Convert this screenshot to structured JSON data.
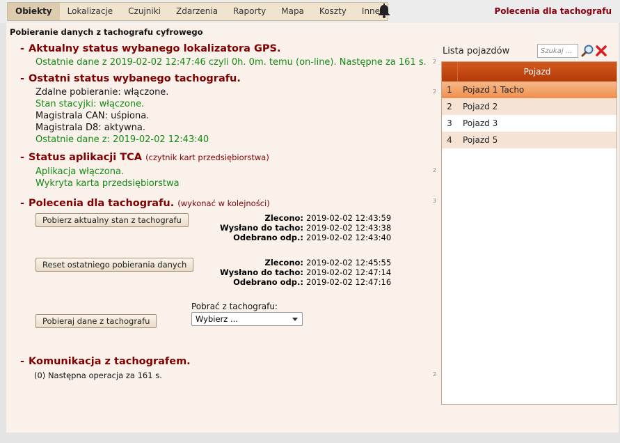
{
  "menu": [
    "Obiekty",
    "Lokalizacje",
    "Czujniki",
    "Zdarzenia",
    "Raporty",
    "Mapa",
    "Koszty",
    "Inne"
  ],
  "page_heading": "Polecenia dla tachografu",
  "subtitle": "Pobieranie danych z tachografu cyfrowego",
  "gps": {
    "title": "Aktualny status wybanego lokalizatora GPS.",
    "line": "Ostatnie dane z 2019-02-02 12:47:46 czyli 0h. 0m. temu (on-line). Następne za 161 s."
  },
  "tacho": {
    "title": "Ostatni status wybanego tachografu.",
    "lines": [
      "Zdalne pobieranie: włączone.",
      "Stan stacyjki: włączone.",
      "Magistrala CAN: uśpiona.",
      "Magistrala D8: aktywna.",
      "Ostatnie dane z: 2019-02-02 12:43:40"
    ]
  },
  "tca": {
    "title": "Status aplikacji TCA",
    "note": "(czytnik kart przedsiębiorstwa)",
    "lines": [
      "Aplikacja włączona.",
      "Wykryta karta przedsiębiorstwa"
    ]
  },
  "commands": {
    "title": "Polecenia dla tachografu.",
    "note": "(wykonać w kolejności)",
    "labels": {
      "ordered": "Zlecono:",
      "sent": "Wysłano do tacho:",
      "received": "Odebrano odp.:"
    },
    "items": [
      {
        "button": "Pobierz aktualny stan z tachografu",
        "ordered": "2019-02-02 12:43:59",
        "sent": "2019-02-02 12:43:38",
        "received": "2019-02-02 12:43:40"
      },
      {
        "button": "Reset ostatniego pobierania danych",
        "ordered": "2019-02-02 12:45:55",
        "sent": "2019-02-02 12:47:14",
        "received": "2019-02-02 12:47:16"
      }
    ],
    "download_button": "Pobieraj dane z tachografu",
    "select_label": "Pobrać z tachografu:",
    "select_value": "Wybierz ..."
  },
  "comm": {
    "title": "Komunikacja z tachografem.",
    "line": "(0) Następna operacja za 161 s."
  },
  "side_numbers": [
    "2",
    "2",
    "2",
    "3",
    "2"
  ],
  "vehicles": {
    "title": "Lista pojazdów",
    "search_placeholder": "Szukaj ...",
    "column": "Pojazd",
    "rows": [
      {
        "num": "1",
        "name": "Pojazd 1 Tacho"
      },
      {
        "num": "2",
        "name": "Pojazd 2"
      },
      {
        "num": "3",
        "name": "Pojazd 3"
      },
      {
        "num": "4",
        "name": "Pojazd 5"
      }
    ]
  },
  "colors": {
    "heading": "#800000",
    "ok": "#138a13",
    "accent": "#c84a12"
  },
  "icons": [
    "bell-icon",
    "search-icon",
    "close-icon"
  ]
}
